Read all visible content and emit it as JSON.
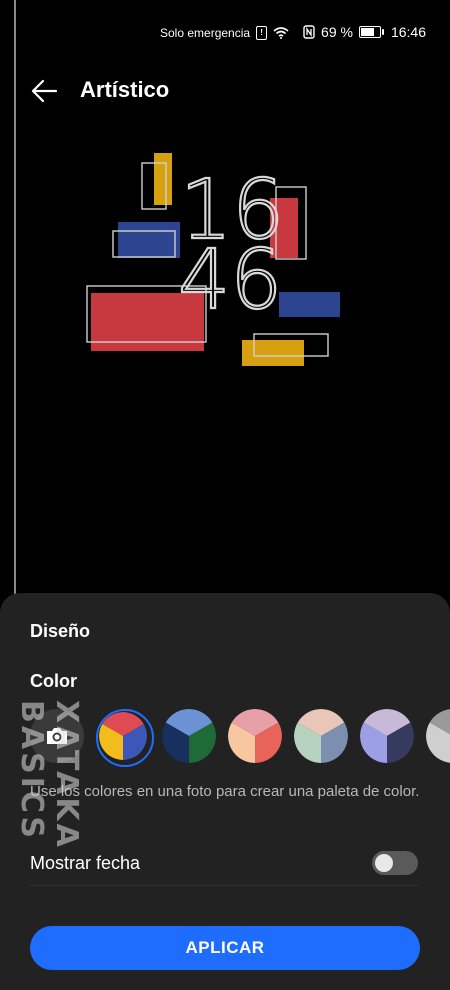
{
  "status_bar": {
    "carrier": "Solo emergencia",
    "battery": "69 %",
    "time": "16:46"
  },
  "header": {
    "title": "Artístico"
  },
  "preview": {
    "hour": "16",
    "minute": "46"
  },
  "sheet": {
    "design_label": "Diseño",
    "color_label": "Color",
    "palettes": [
      {
        "name": "camera",
        "colors": []
      },
      {
        "name": "palette-1",
        "colors": [
          "#e04a52",
          "#3c57b8",
          "#f2bc1d"
        ],
        "selected": true
      },
      {
        "name": "palette-2",
        "colors": [
          "#6c92d6",
          "#1e6b38",
          "#17305e"
        ]
      },
      {
        "name": "palette-3",
        "colors": [
          "#e8a0a8",
          "#e8645a",
          "#f6c7a0"
        ]
      },
      {
        "name": "palette-4",
        "colors": [
          "#e8c7b8",
          "#7d8fb0",
          "#b8d2c0"
        ]
      },
      {
        "name": "palette-5",
        "colors": [
          "#c9b9d8",
          "#353a5e",
          "#9d9fe6"
        ]
      },
      {
        "name": "palette-6",
        "colors": [
          "#9a9a9a",
          "#4e4e4e",
          "#cfcfcf"
        ]
      }
    ],
    "hint": "Use los colores en una foto para crear una paleta de color.",
    "show_date_label": "Mostrar fecha",
    "show_date_enabled": false,
    "apply_label": "APLICAR"
  },
  "colors": {
    "accent": "#1f6dff",
    "sheet_bg": "#222223",
    "red": "#c8393f",
    "blue": "#2d4590",
    "yellow": "#d6a010"
  },
  "watermark": {
    "text": "XATAKA BASICS"
  }
}
